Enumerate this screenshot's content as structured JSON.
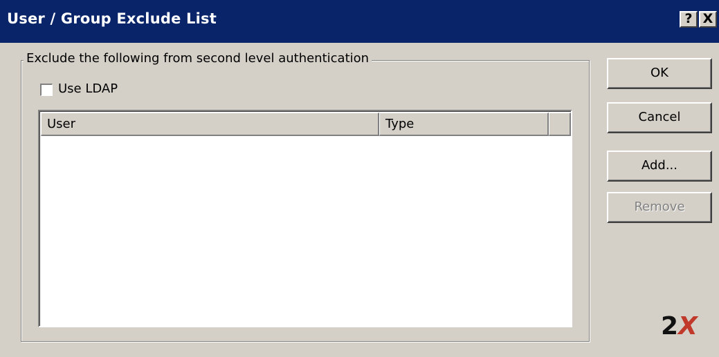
{
  "window": {
    "title": "User / Group Exclude List",
    "help_glyph": "?",
    "close_glyph": "X"
  },
  "group": {
    "legend": "Exclude the following from second level authentication",
    "use_ldap_label": "Use LDAP",
    "use_ldap_checked": false
  },
  "list": {
    "columns": [
      "User",
      "Type"
    ],
    "rows": []
  },
  "buttons": {
    "ok": "OK",
    "cancel": "Cancel",
    "add": "Add...",
    "remove": "Remove"
  },
  "logo": {
    "text_a": "2",
    "text_b": "X"
  },
  "colors": {
    "titlebar": "#0a246a",
    "face": "#d4d0c8",
    "logo_accent": "#c0392b"
  }
}
